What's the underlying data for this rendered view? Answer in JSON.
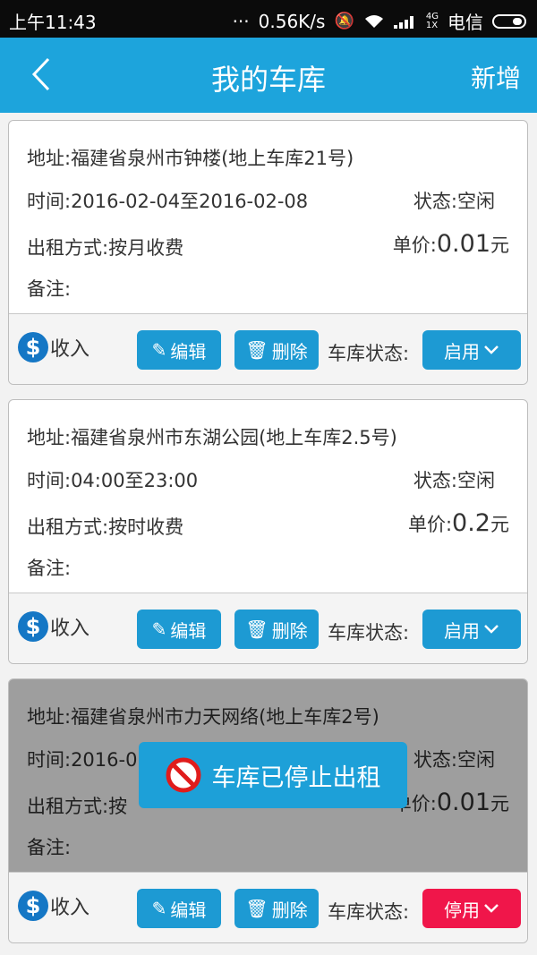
{
  "status_bar": {
    "time": "上午11:43",
    "speed": "0.56K/s",
    "network": "4G",
    "network_sub": "1X",
    "carrier": "电信"
  },
  "nav": {
    "title": "我的车库",
    "add_label": "新增"
  },
  "labels": {
    "income": "收入",
    "edit": "编辑",
    "delete": "删除",
    "garage_status": "车库状态:"
  },
  "garages": [
    {
      "address": "地址:福建省泉州市钟楼(地上车库21号)",
      "time": "时间:2016-02-04至2016-02-08",
      "state": "状态:空闲",
      "rent_mode": "出租方式:按月收费",
      "price_prefix": "单价:",
      "price_value": "0.01",
      "price_unit": "元",
      "note": "备注:",
      "toggle": "启用"
    },
    {
      "address": "地址:福建省泉州市东湖公园(地上车库2.5号)",
      "time": "时间:04:00至23:00",
      "state": "状态:空闲",
      "rent_mode": "出租方式:按时收费",
      "price_prefix": "单价:",
      "price_value": "0.2",
      "price_unit": "元",
      "note": "备注:",
      "toggle": "启用"
    },
    {
      "address": "地址:福建省泉州市力天网络(地上车库2号)",
      "time": "时间:2016-0",
      "state": "状态:空闲",
      "rent_mode": "出租方式:按",
      "price_prefix": "单价:",
      "price_value": "0.01",
      "price_unit": "元",
      "note": "备注:",
      "toggle": "停用",
      "toast": "车库已停止出租"
    }
  ],
  "colors": {
    "accent": "#1da4dc",
    "button": "#1d9ad3",
    "disabled": "#f0164a"
  }
}
